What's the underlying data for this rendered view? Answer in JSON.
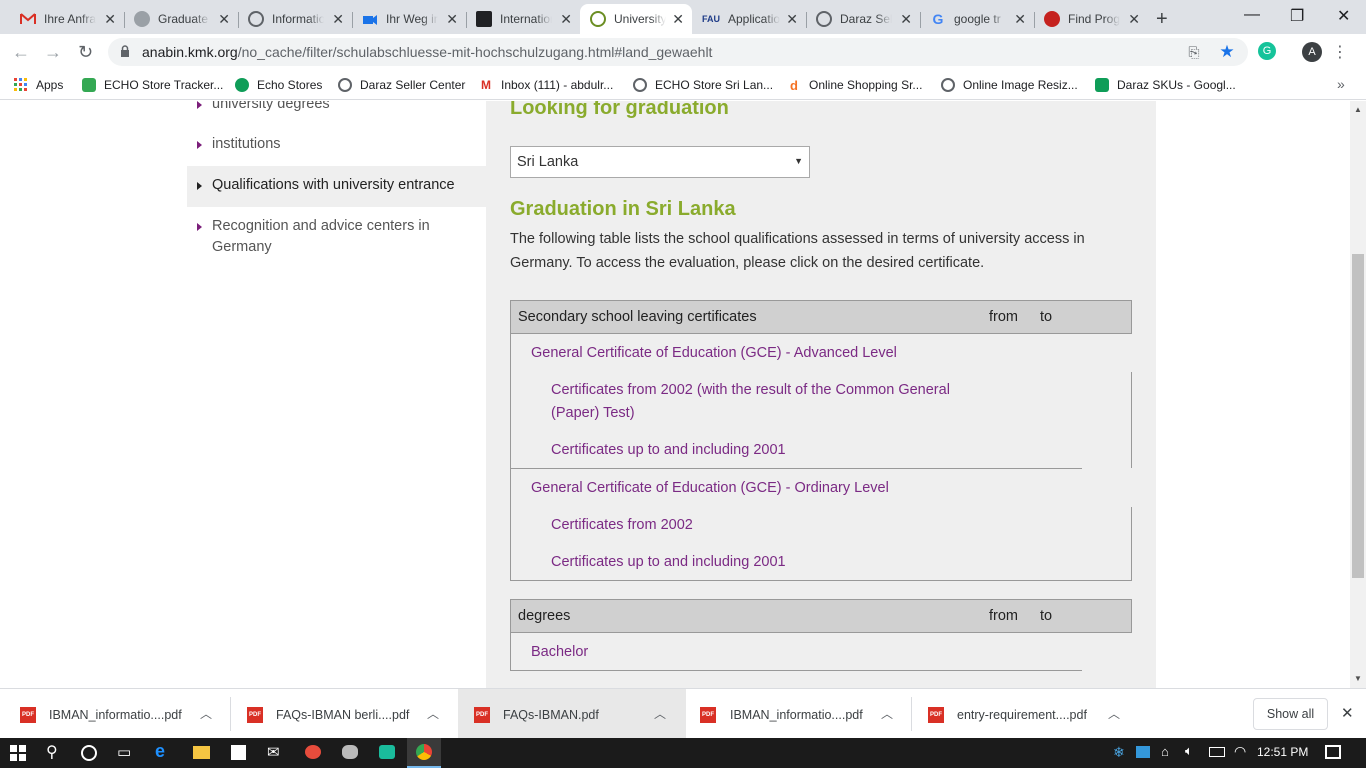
{
  "tabs": [
    {
      "title": "Ihre Anfrage",
      "icon": "gmail-icon"
    },
    {
      "title": "Graduate",
      "icon": "globe-icon"
    },
    {
      "title": "Information",
      "icon": "globe-icon"
    },
    {
      "title": "Ihr Weg ins",
      "icon": "camera-icon"
    },
    {
      "title": "International",
      "icon": "logo-icon"
    },
    {
      "title": "University",
      "icon": "anabin-icon"
    },
    {
      "title": "Application",
      "icon": "fau-icon"
    },
    {
      "title": "Daraz Seller",
      "icon": "globe-icon"
    },
    {
      "title": "google tr",
      "icon": "google-icon"
    },
    {
      "title": "Find Prog",
      "icon": "daad-icon"
    }
  ],
  "fav_text": {
    "fau": "FAU"
  },
  "address": {
    "host": "anabin.kmk.org",
    "path": "/no_cache/filter/schulabschluesse-mit-hochschulzugang.html#land_gewaehlt"
  },
  "profile_letter": "A",
  "bookmarks": [
    {
      "label": "Apps"
    },
    {
      "label": "ECHO Store Tracker..."
    },
    {
      "label": "Echo Stores"
    },
    {
      "label": "Daraz Seller Center"
    },
    {
      "label": "Inbox (111) - abdulr..."
    },
    {
      "label": "ECHO Store Sri Lan..."
    },
    {
      "label": "Online Shopping Sr..."
    },
    {
      "label": "Online Image Resiz..."
    },
    {
      "label": "Daraz SKUs - Googl..."
    }
  ],
  "sidebar": {
    "items": [
      {
        "label": "university degrees"
      },
      {
        "label": "institutions"
      },
      {
        "label": "Qualifications with university entrance"
      },
      {
        "label": "Recognition and advice centers in Germany"
      }
    ]
  },
  "main": {
    "looking_heading": "Looking for graduation",
    "country_selected": "Sri Lanka",
    "graduation_heading": "Graduation in Sri Lanka",
    "intro": "The following table lists the school qualifications assessed in terms of university access in Germany. To access the evaluation, please click on the desired certificate.",
    "table1": {
      "col_title": "Secondary school leaving certificates",
      "col_from": "from",
      "col_to": "to",
      "group1": "General Certificate of Education (GCE) - Advanced Level",
      "group1_items": [
        "Certificates from 2002 (with the result of the Common General (Paper) Test)",
        "Certificates up to and including 2001"
      ],
      "group2": "General Certificate of Education (GCE) - Ordinary Level",
      "group2_items": [
        "Certificates from 2002",
        "Certificates up to and including 2001"
      ]
    },
    "table2": {
      "col_title": "degrees",
      "col_from": "from",
      "col_to": "to",
      "row1": "Bachelor"
    }
  },
  "downloads": {
    "items": [
      {
        "name": "IBMAN_informatio....pdf"
      },
      {
        "name": "FAQs-IBMAN berli....pdf"
      },
      {
        "name": "FAQs-IBMAN.pdf"
      },
      {
        "name": "IBMAN_informatio....pdf"
      },
      {
        "name": "entry-requirement....pdf"
      }
    ],
    "show_all": "Show all",
    "pdf_badge": "PDF"
  },
  "taskbar": {
    "time": "12:51 PM"
  },
  "colors": {
    "accent_green": "#8aab2d",
    "link_purple": "#7b2a84"
  }
}
